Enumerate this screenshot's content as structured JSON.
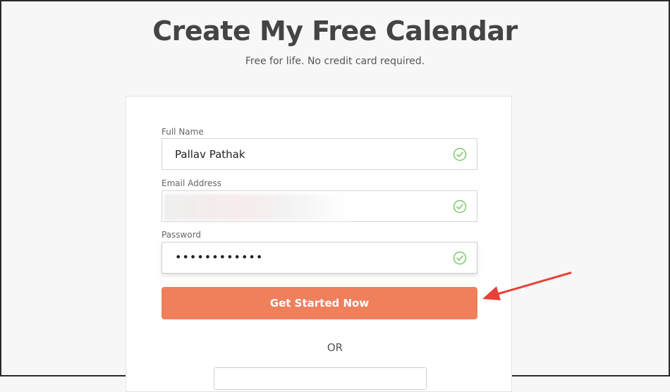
{
  "header": {
    "title": "Create My Free Calendar",
    "subtitle": "Free for life. No credit card required."
  },
  "form": {
    "full_name": {
      "label": "Full Name",
      "value": "Pallav Pathak",
      "valid": true
    },
    "email": {
      "label": "Email Address",
      "value": "",
      "valid": true
    },
    "password": {
      "label": "Password",
      "value": "••••••••••••",
      "valid": true
    },
    "submit_label": "Get Started Now",
    "divider_label": "OR"
  },
  "colors": {
    "cta": "#f07f5c",
    "check": "#7cc86a",
    "annotation_arrow": "#e8413a"
  }
}
